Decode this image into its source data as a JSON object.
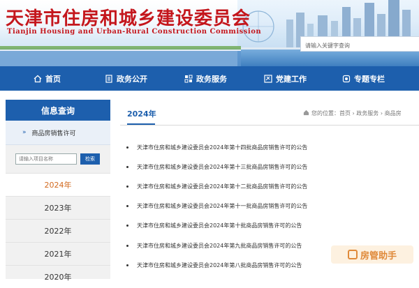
{
  "header": {
    "title_cn": "天津市住房和城乡建设委员会",
    "title_en": "Tianjin Housing and Urban-Rural Construction Commission",
    "search_placeholder": "请输入关键字查询"
  },
  "nav": [
    {
      "label": "首页",
      "icon": "home-icon"
    },
    {
      "label": "政务公开",
      "icon": "document-icon"
    },
    {
      "label": "政务服务",
      "icon": "services-icon"
    },
    {
      "label": "党建工作",
      "icon": "party-icon"
    },
    {
      "label": "专题专栏",
      "icon": "topics-icon"
    }
  ],
  "sidebar": {
    "heading": "信息查询",
    "subitem": "商品房销售许可",
    "subitem_icon": "arrow-icon",
    "search_placeholder": "请输入项目名称",
    "search_button": "检索",
    "years": [
      "2024年",
      "2023年",
      "2022年",
      "2021年",
      "2020年"
    ],
    "active_year": "2024年"
  },
  "content": {
    "title": "2024年",
    "breadcrumb": "您的位置：首页 › 政务服务 › 商品房",
    "notices": [
      "天津市住房和城乡建设委员会2024年第十四批商品房销售许可的公告",
      "天津市住房和城乡建设委员会2024年第十三批商品房销售许可的公告",
      "天津市住房和城乡建设委员会2024年第十二批商品房销售许可的公告",
      "天津市住房和城乡建设委员会2024年第十一批商品房销售许可的公告",
      "天津市住房和城乡建设委员会2024年第十批商品房销售许可的公告",
      "天津市住房和城乡建设委员会2024年第九批商品房销售许可的公告",
      "天津市住房和城乡建设委员会2024年第八批商品房销售许可的公告"
    ]
  },
  "watermark": {
    "text": "房管助手"
  },
  "colors": {
    "primary": "#1d5fad",
    "title_red": "#c4161c",
    "active_year": "#d2691e"
  }
}
